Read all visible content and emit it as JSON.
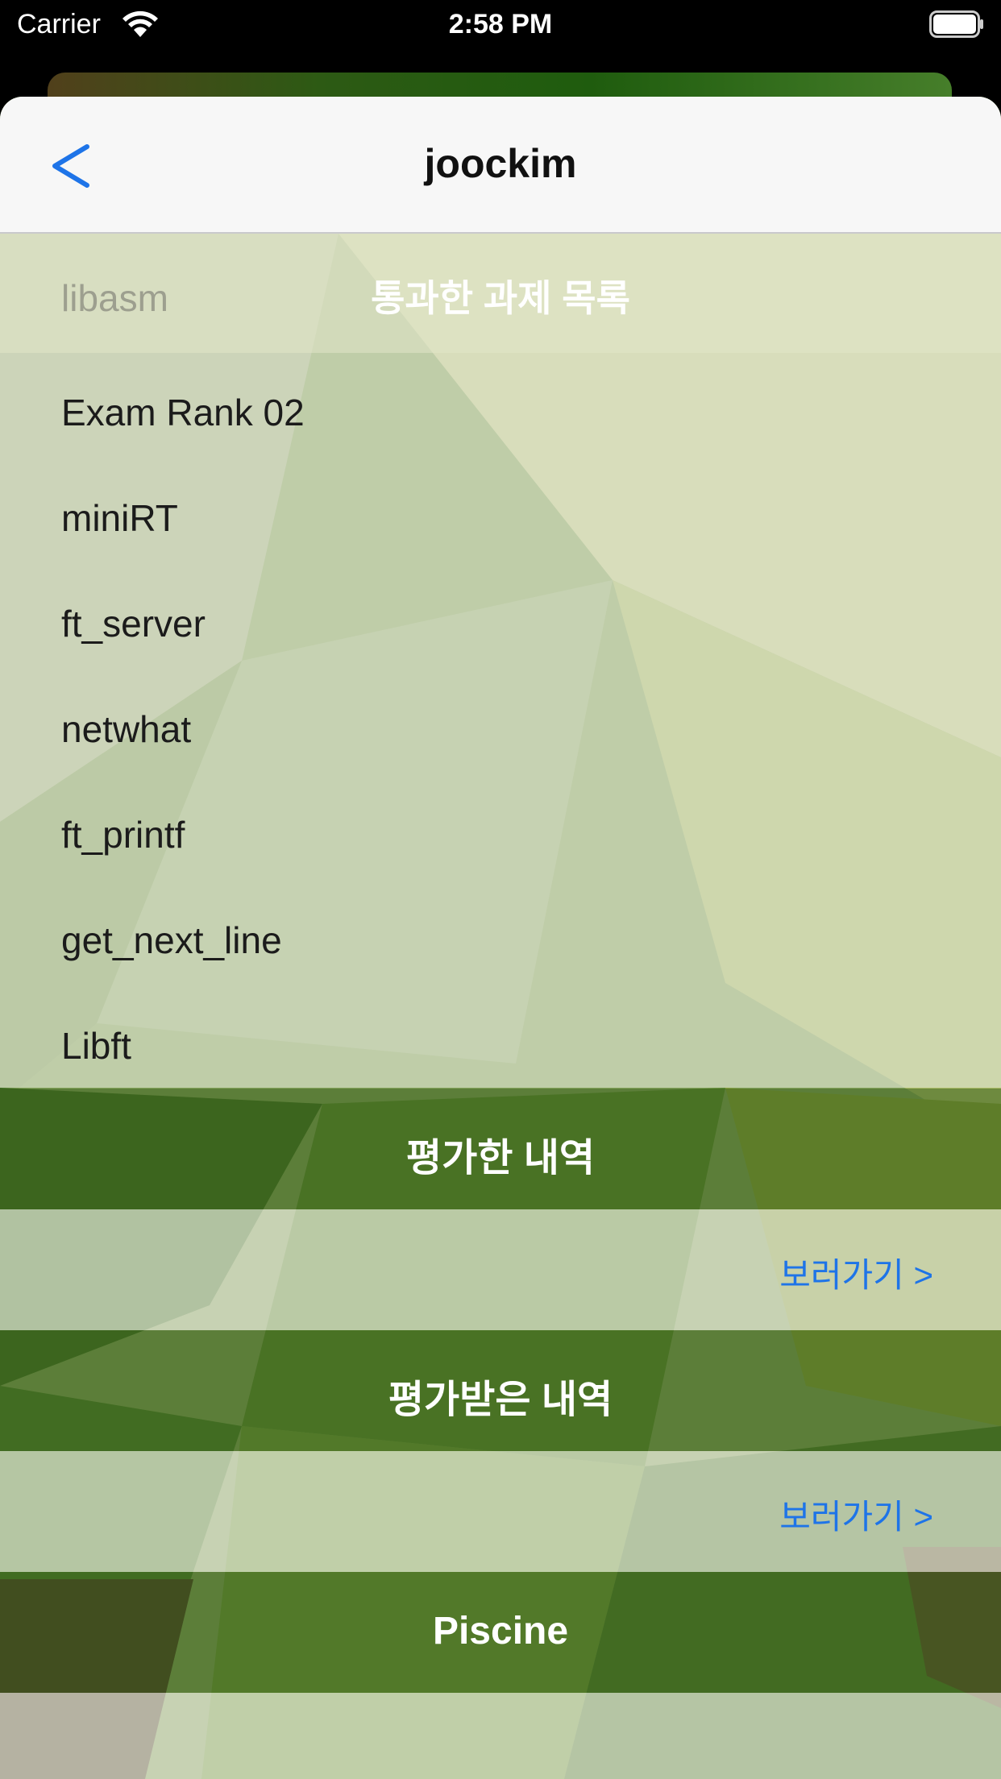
{
  "status_bar": {
    "carrier": "Carrier",
    "time": "2:58 PM"
  },
  "nav": {
    "back_icon": "chevron-left-icon",
    "title": "joockim",
    "accent_color": "#1e74e8"
  },
  "projects_section": {
    "header": "통과한 과제 목록",
    "items": [
      "libasm",
      "Exam Rank 02",
      "miniRT",
      "ft_server",
      "netwhat",
      "ft_printf",
      "get_next_line",
      "Libft"
    ]
  },
  "evaluations_given": {
    "header": "평가한 내역",
    "link": "보러가기 >"
  },
  "evaluations_received": {
    "header": "평가받은 내역",
    "link": "보러가기 >"
  },
  "piscine_section": {
    "header": "Piscine"
  }
}
